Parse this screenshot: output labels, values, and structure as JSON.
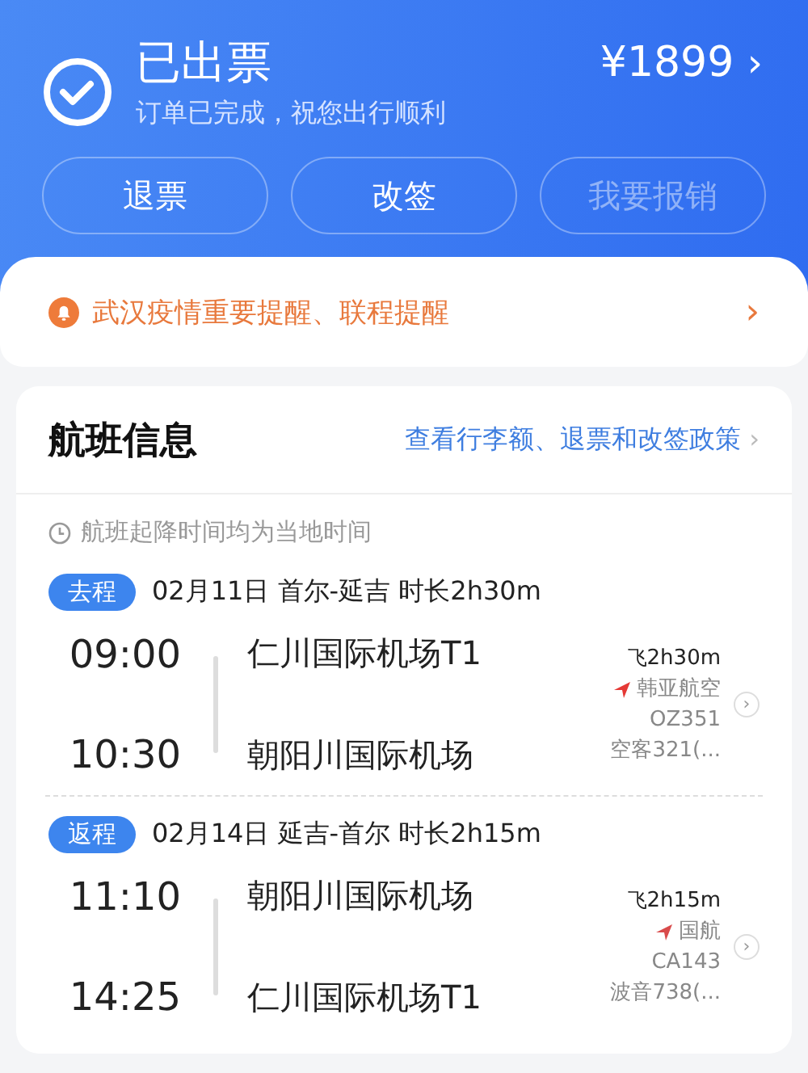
{
  "status": {
    "title": "已出票",
    "subtitle": "订单已完成，祝您出行顺利",
    "price": "¥1899",
    "chevron": "›"
  },
  "actions": [
    {
      "label": "退票",
      "disabled": false
    },
    {
      "label": "改签",
      "disabled": false
    },
    {
      "label": "我要报销",
      "disabled": true
    }
  ],
  "notice": {
    "text": "武汉疫情重要提醒、联程提醒",
    "chevron": "›"
  },
  "flight_info": {
    "title": "航班信息",
    "policy_link": "查看行李额、退票和改签政策",
    "policy_chevron": "›",
    "time_note": "航班起降时间均为当地时间",
    "segments": [
      {
        "tag": "去程",
        "summary": "02月11日 首尔-延吉 时长2h30m",
        "depart_time": "09:00",
        "depart_airport": "仁川国际机场T1",
        "arrive_time": "10:30",
        "arrive_airport": "朝阳川国际机场",
        "plane_glyph": "飞",
        "duration": "2h30m",
        "airline": "韩亚航空",
        "color": "#e53935",
        "flight_no": "OZ351",
        "aircraft": "空客321(...",
        "chevron": "›"
      },
      {
        "tag": "返程",
        "summary": "02月14日 延吉-首尔 时长2h15m",
        "depart_time": "11:10",
        "depart_airport": "朝阳川国际机场",
        "arrive_time": "14:25",
        "arrive_airport": "仁川国际机场T1",
        "plane_glyph": "飞",
        "duration": "2h15m",
        "airline": "国航",
        "color": "#d94b4b",
        "flight_no": "CA143",
        "aircraft": "波音738(...",
        "chevron": "›"
      }
    ]
  }
}
